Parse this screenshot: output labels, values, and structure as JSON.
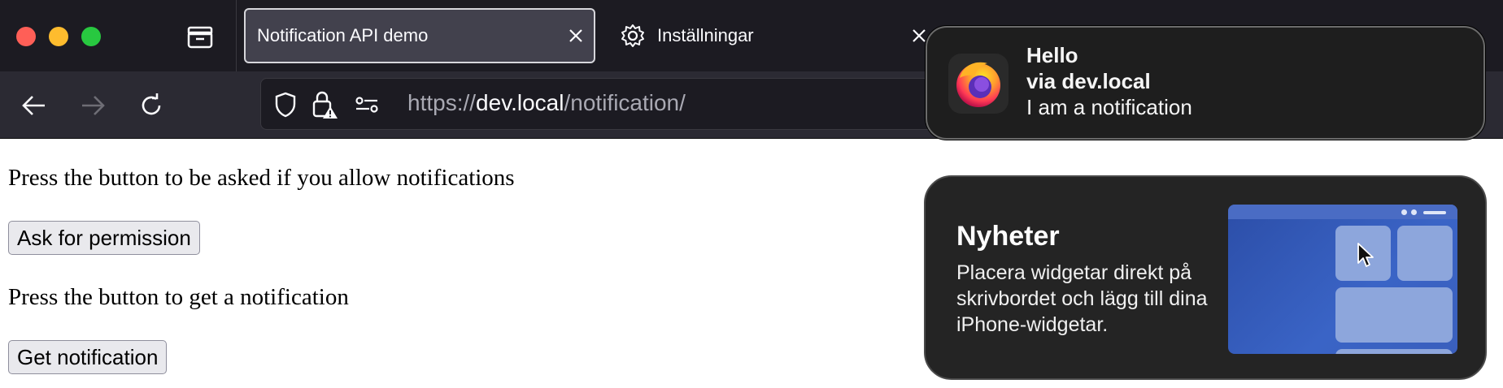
{
  "tabs": [
    {
      "label": "Notification API demo",
      "active": true
    },
    {
      "label": "Inställningar",
      "active": false
    }
  ],
  "address": {
    "scheme": "https://",
    "host": "dev.local",
    "path": "/notification/"
  },
  "page": {
    "prompt1": "Press the button to be asked if you allow notifications",
    "button1": "Ask for permission",
    "prompt2": "Press the button to get a notification",
    "button2": "Get notification"
  },
  "notification": {
    "title": "Hello",
    "source": "via dev.local",
    "body": "I am a notification",
    "app_icon": "firefox-icon"
  },
  "widget_promo": {
    "title": "Nyheter",
    "description": "Placera widgetar direkt på skrivbordet och lägg till dina iPhone-widgetar."
  },
  "colors": {
    "traffic_red": "#ff5f57",
    "traffic_yellow": "#febc2e",
    "traffic_green": "#28c840",
    "chrome_dark": "#1c1b22",
    "widget_blue": "#3a64c6"
  },
  "icons": [
    "tab-overview-icon",
    "close-icon",
    "gear-icon",
    "back-arrow-icon",
    "forward-arrow-icon",
    "reload-icon",
    "shield-icon",
    "lock-warning-icon",
    "permissions-icon",
    "firefox-icon",
    "cursor-icon"
  ]
}
